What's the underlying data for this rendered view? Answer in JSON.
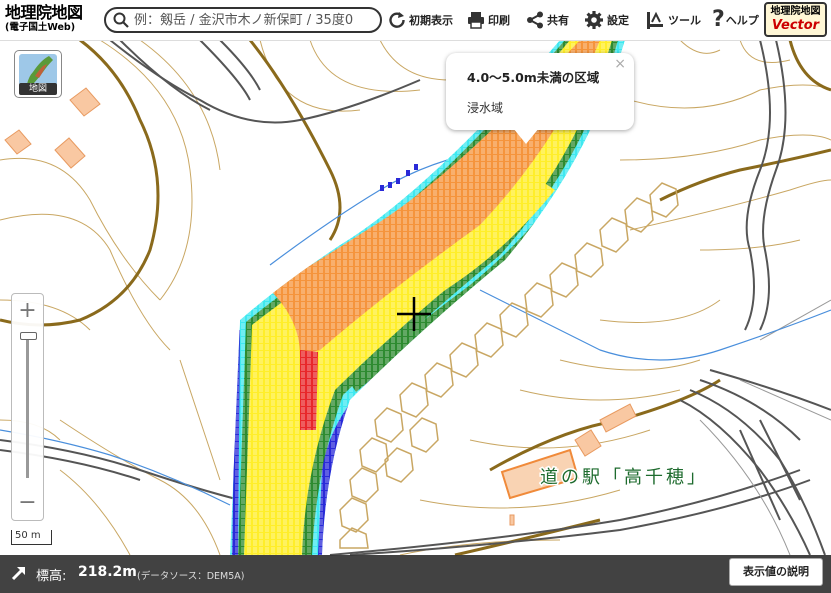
{
  "header": {
    "brand_main": "地理院地図",
    "brand_sub": "(電子国土Web)",
    "search_placeholder": "例：剱岳 / 金沢市木ノ新保町 / 35度0",
    "buttons": [
      {
        "label": "初期表示",
        "icon": "refresh-icon"
      },
      {
        "label": "印刷",
        "icon": "print-icon"
      },
      {
        "label": "共有",
        "icon": "share-icon"
      },
      {
        "label": "設定",
        "icon": "gear-icon"
      },
      {
        "label": "ツール",
        "icon": "tool-icon"
      },
      {
        "label": "ヘルプ",
        "icon": "help-icon"
      }
    ],
    "vector_top": "地理院地図",
    "vector_bottom": "Vector"
  },
  "layer_button_label": "地図",
  "zoom": {
    "in": "+",
    "out": "−"
  },
  "scale_label": "50 m",
  "popup": {
    "title": "4.0〜5.0m未満の区域",
    "body": "浸水域",
    "close": "×"
  },
  "map_labels": {
    "station": "道の駅「高千穂」"
  },
  "bottom_bar": {
    "elev_label": "標高:",
    "elev_value": "218.2m",
    "source": "(データソース：DEM5A)",
    "explain_button": "表示値の説明"
  },
  "colors": {
    "flood_orange": "#f5943c",
    "flood_yellow": "#ffee2a",
    "flood_green": "#2e8b30",
    "flood_cyan": "#3fe8f0",
    "flood_blue": "#2a2ad8",
    "flood_red": "#e8272a",
    "contour": "#8a6a1c",
    "road": "#555555",
    "river": "#4a8fdc",
    "building": "#f9c8a2"
  }
}
